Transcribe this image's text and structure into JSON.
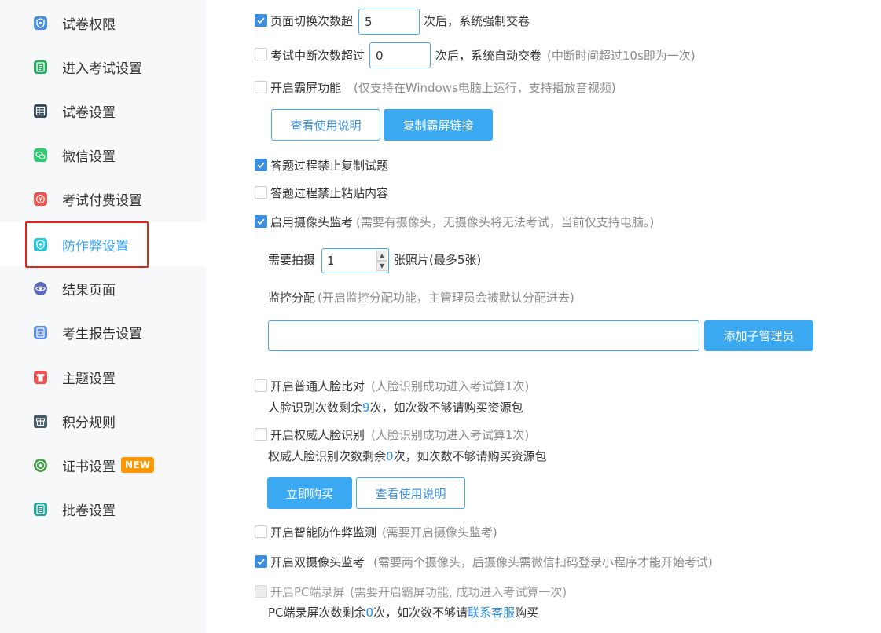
{
  "sidebar": {
    "items": [
      {
        "label": "试卷权限",
        "icon": "shield-lock-icon",
        "color": "#4a90e2"
      },
      {
        "label": "进入考试设置",
        "icon": "document-list-icon",
        "color": "#27ae60"
      },
      {
        "label": "试卷设置",
        "icon": "grid-sheet-icon",
        "color": "#34495e"
      },
      {
        "label": "微信设置",
        "icon": "wechat-icon",
        "color": "#2ecc71"
      },
      {
        "label": "考试付费设置",
        "icon": "yen-coin-icon",
        "color": "#ef5350"
      },
      {
        "label": "防作弊设置",
        "icon": "shield-plus-icon",
        "color": "#26c6da"
      },
      {
        "label": "结果页面",
        "icon": "eye-icon",
        "color": "#5c6bc0"
      },
      {
        "label": "考生报告设置",
        "icon": "report-icon",
        "color": "#5b8def"
      },
      {
        "label": "主题设置",
        "icon": "shirt-icon",
        "color": "#ef5350"
      },
      {
        "label": "积分规则",
        "icon": "gift-icon",
        "color": "#455a64"
      },
      {
        "label": "证书设置",
        "icon": "certificate-icon",
        "color": "#43a047"
      },
      {
        "label": "批卷设置",
        "icon": "marking-icon",
        "color": "#26a69a"
      }
    ],
    "active_index": 5,
    "new_badge": "NEW"
  },
  "settings": {
    "page_switch": {
      "checked": true,
      "label": "页面切换次数超",
      "value": "5",
      "suffix": "次后，系统强制交卷"
    },
    "interrupt": {
      "checked": false,
      "label": "考试中断次数超过",
      "value": "0",
      "suffix": "次后，系统自动交卷",
      "hint": "(中断时间超过10s即为一次)"
    },
    "lockscreen": {
      "checked": false,
      "label": "开启霸屏功能",
      "hint": "(仅支持在Windows电脑上运行，支持播放音视频)",
      "btn_guide": "查看使用说明",
      "btn_copy": "复制霸屏链接"
    },
    "no_copy": {
      "checked": true,
      "label": "答题过程禁止复制试题"
    },
    "no_paste": {
      "checked": false,
      "label": "答题过程禁止粘贴内容"
    },
    "camera": {
      "checked": true,
      "label": "启用摄像头监考",
      "hint": "(需要有摄像头，无摄像头将无法考试，当前仅支持电脑。)"
    },
    "photos": {
      "label": "需要拍摄",
      "value": "1",
      "suffix": "张照片(最多5张)",
      "up": "▲",
      "down": "▼"
    },
    "monitor": {
      "label": "监控分配",
      "hint": "(开启监控分配功能，主管理员会被默认分配进去)",
      "input_value": "",
      "btn_add": "添加子管理员"
    },
    "face_normal": {
      "checked": false,
      "label": "开启普通人脸比对",
      "hint": "(人脸识别成功进入考试算1次)",
      "remain_prefix": "人脸识别次数剩余",
      "remain_count": "9",
      "remain_suffix": "次，如次数不够请购买资源包"
    },
    "face_auth": {
      "checked": false,
      "label": "开启权威人脸识别",
      "hint": "(人脸识别成功进入考试算1次)",
      "remain_prefix": "权威人脸识别次数剩余",
      "remain_count": "0",
      "remain_suffix": "次，如次数不够请购买资源包",
      "btn_buy": "立即购买",
      "btn_guide": "查看使用说明"
    },
    "smart_detect": {
      "checked": false,
      "label": "开启智能防作弊监测",
      "hint": "(需要开启摄像头监考)"
    },
    "dual_camera": {
      "checked": true,
      "label": "开启双摄像头监考",
      "hint": "(需要两个摄像头，后摄像头需微信扫码登录小程序才能开始考试)"
    },
    "pc_record": {
      "checked": false,
      "disabled": true,
      "label": "开启PC端录屏",
      "hint": "(需要开启霸屏功能, 成功进入考试算一次)",
      "remain_prefix": "PC端录屏次数剩余",
      "remain_count": "0",
      "remain_mid": "次，如次数不够请",
      "contact_link": "联系客服",
      "remain_suffix": "购买"
    }
  }
}
